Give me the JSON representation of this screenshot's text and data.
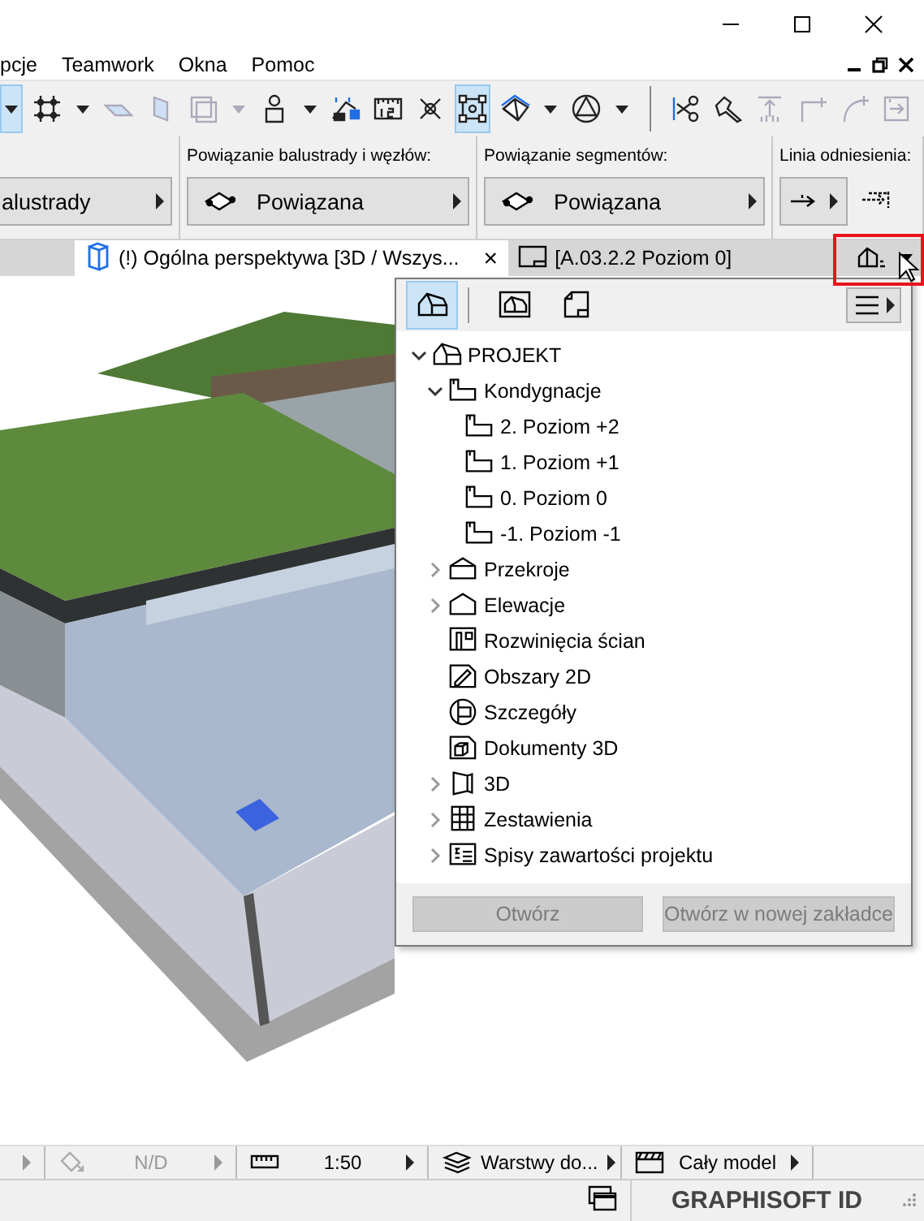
{
  "menu": [
    "pcje",
    "Teamwork",
    "Okna",
    "Pomoc"
  ],
  "toolbar": [
    {
      "tools": [
        {
          "kind": "caret",
          "selected": true,
          "disabled": false
        },
        {
          "kind": "gridsnap",
          "selected": false,
          "disabled": false
        },
        {
          "kind": "caret",
          "selected": false,
          "disabled": false
        },
        {
          "kind": "slab",
          "selected": false,
          "disabled": true
        },
        {
          "kind": "panel",
          "selected": false,
          "disabled": true
        },
        {
          "kind": "square",
          "selected": false,
          "disabled": true
        },
        {
          "kind": "caret",
          "selected": false,
          "disabled": true
        },
        {
          "kind": "figure",
          "selected": false,
          "disabled": false
        },
        {
          "kind": "caret",
          "selected": false,
          "disabled": false
        },
        {
          "kind": "guides",
          "selected": false,
          "disabled": false
        },
        {
          "kind": "ruler",
          "selected": false,
          "disabled": false
        },
        {
          "kind": "cross",
          "selected": false,
          "disabled": false
        },
        {
          "kind": "selectframe",
          "selected": true,
          "disabled": false
        },
        {
          "kind": "cuberot",
          "selected": false,
          "disabled": false
        },
        {
          "kind": "caret",
          "selected": false,
          "disabled": false
        },
        {
          "kind": "tricircle",
          "selected": false,
          "disabled": false
        },
        {
          "kind": "caret",
          "selected": false,
          "disabled": false
        }
      ]
    },
    {
      "tools": [
        {
          "kind": "scissors",
          "selected": false,
          "disabled": false
        },
        {
          "kind": "magic",
          "selected": false,
          "disabled": false
        },
        {
          "kind": "elevate",
          "selected": false,
          "disabled": true
        },
        {
          "kind": "corner",
          "selected": false,
          "disabled": true
        },
        {
          "kind": "arc",
          "selected": false,
          "disabled": true
        },
        {
          "kind": "boxarrow",
          "selected": false,
          "disabled": true
        }
      ]
    }
  ],
  "info_box": [
    {
      "kind": "dropdown",
      "button": "alustrady"
    },
    {
      "kind": "dropdown-icon",
      "label": "Powiązanie balustrady i węzłów:",
      "button": "Powiązana"
    },
    {
      "kind": "dropdown-icon",
      "label": "Powiązanie segmentów:",
      "button": "Powiązana"
    },
    {
      "kind": "reference",
      "label": "Linia odniesienia:"
    }
  ],
  "tabs": [
    {
      "kind": "perspective",
      "label": "(!) Ogólna perspektywa [3D / Wszys...",
      "selected": true,
      "close": "×"
    },
    {
      "kind": "plan",
      "label": "[A.03.2.2 Poziom 0]",
      "selected": false
    }
  ],
  "navigator": {
    "tabs": [
      {
        "kind": "project",
        "selected": true
      },
      {
        "kind": "views",
        "selected": false
      },
      {
        "kind": "layouts",
        "selected": false
      }
    ],
    "tree": [
      {
        "kind": "project",
        "label": "PROJEKT",
        "expanded": true,
        "children": [
          {
            "kind": "stories",
            "label": "Kondygnacje",
            "expanded": true,
            "children": [
              {
                "kind": "story",
                "label": "2. Poziom +2"
              },
              {
                "kind": "story",
                "label": "1. Poziom +1"
              },
              {
                "kind": "story",
                "label": "0. Poziom 0"
              },
              {
                "kind": "story",
                "label": "-1. Poziom -1"
              }
            ]
          },
          {
            "kind": "section",
            "label": "Przekroje",
            "expanded": false
          },
          {
            "kind": "elevation",
            "label": "Elewacje",
            "expanded": false
          },
          {
            "kind": "interior",
            "label": "Rozwinięcia ścian"
          },
          {
            "kind": "worksheet",
            "label": "Obszary 2D"
          },
          {
            "kind": "detail",
            "label": "Szczegóły"
          },
          {
            "kind": "document3d",
            "label": "Dokumenty 3D"
          },
          {
            "kind": "view3d",
            "label": "3D",
            "expanded": false
          },
          {
            "kind": "schedule",
            "label": "Zestawienia",
            "expanded": false
          },
          {
            "kind": "index",
            "label": "Spisy zawartości projektu",
            "expanded": false
          }
        ]
      }
    ],
    "buttons": [
      {
        "label": "Otwórz",
        "disabled": true
      },
      {
        "label": "Otwórz w nowej zakładce",
        "disabled": true
      }
    ]
  },
  "status_bar": {
    "segments": [
      {
        "kind": "renovation",
        "text": "N/D",
        "disabled": true
      },
      {
        "kind": "scale",
        "text": "1:50",
        "disabled": false
      },
      {
        "kind": "layers",
        "text": "Warstwy do...",
        "disabled": false
      },
      {
        "kind": "model",
        "text": "Cały model",
        "disabled": false
      }
    ],
    "account": "GRAPHISOFT ID"
  }
}
